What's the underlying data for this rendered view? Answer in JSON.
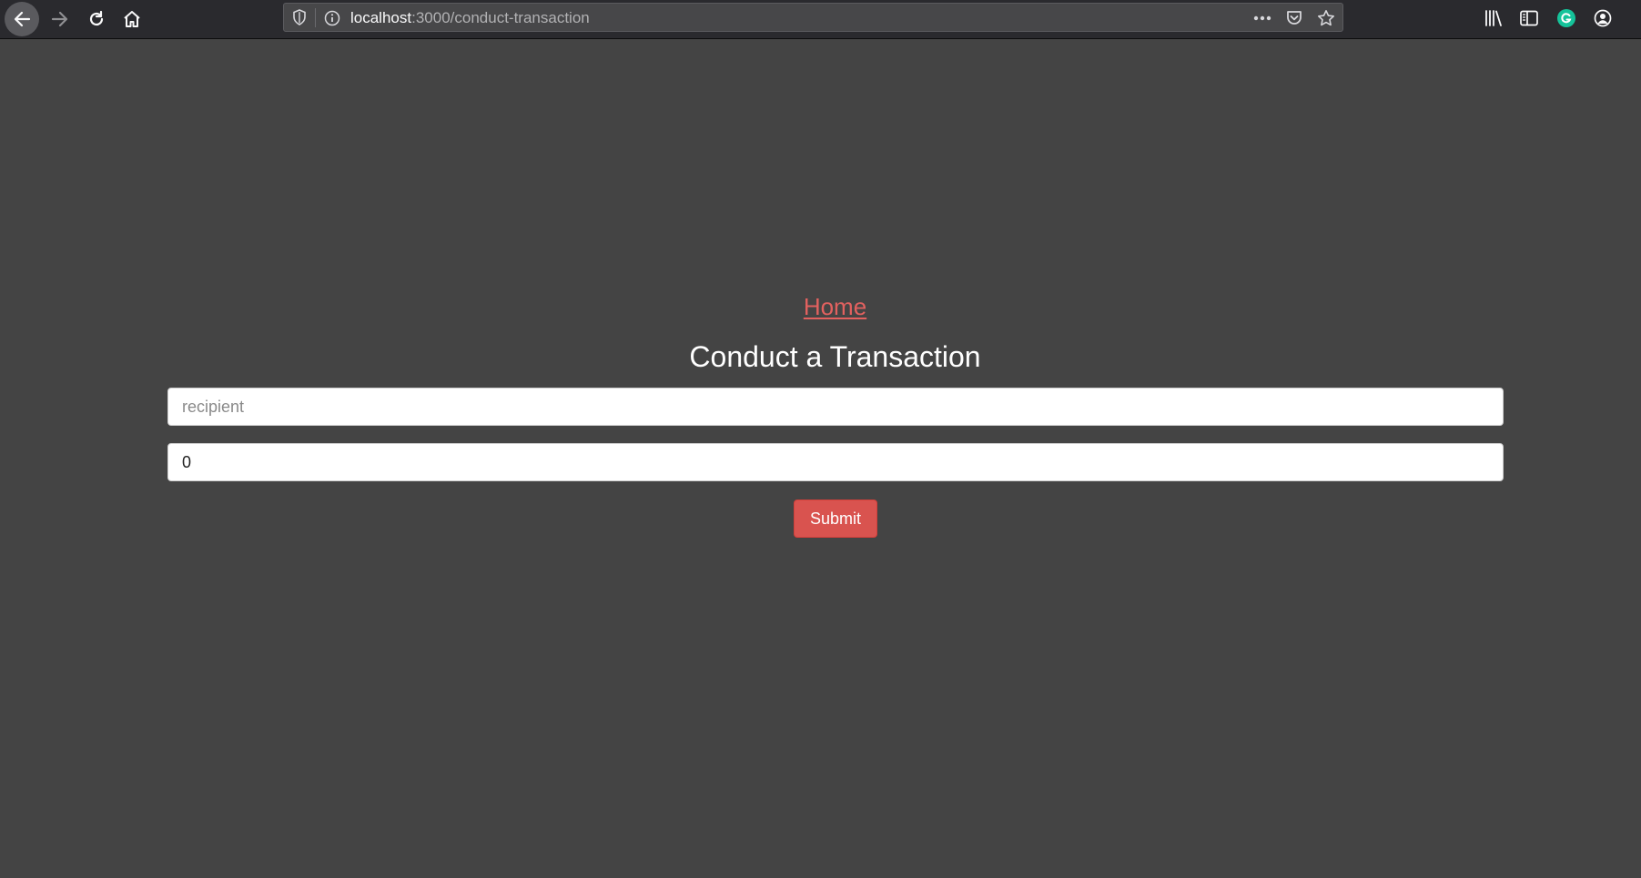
{
  "browser": {
    "url_host": "localhost",
    "url_path": ":3000/conduct-transaction",
    "icons": {
      "back": "back-arrow-icon",
      "forward": "forward-arrow-icon",
      "reload": "reload-icon",
      "home": "home-icon",
      "shield": "tracking-shield-icon",
      "info": "site-info-icon",
      "more": "more-actions-icon",
      "pocket": "pocket-icon",
      "bookmark": "bookmark-star-icon",
      "library": "library-icon",
      "sidebar": "sidebar-icon",
      "grammarly": "grammarly-icon",
      "account": "account-icon"
    }
  },
  "page": {
    "home_link": "Home",
    "title": "Conduct a Transaction",
    "recipient_placeholder": "recipient",
    "recipient_value": "",
    "amount_value": "0",
    "submit_label": "Submit"
  },
  "colors": {
    "background": "#444444",
    "link": "#e2615f",
    "button": "#d9534f"
  }
}
